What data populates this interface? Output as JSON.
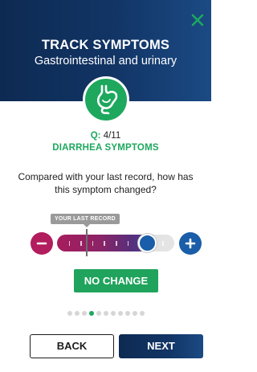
{
  "colors": {
    "header": "#123566",
    "accent_green": "#1da85e",
    "minus": "#b21d5e",
    "plus": "#1a5da8",
    "badge": "#20a35c"
  },
  "header": {
    "title": "TRACK SYMPTOMS",
    "subtitle": "Gastrointestinal and urinary",
    "close_icon": "close-icon"
  },
  "category": {
    "icon": "stomach-icon"
  },
  "question": {
    "prefix": "Q:",
    "count": "4/11",
    "symptom": "DIARRHEA SYMPTOMS",
    "text": "Compared with your last record, how has this symptom changed?"
  },
  "slider": {
    "last_record_label": "YOUR LAST RECORD",
    "level": 0.82,
    "last_record_level": 0.25,
    "minus_icon": "minus-icon",
    "plus_icon": "plus-icon"
  },
  "result": {
    "label": "NO CHANGE"
  },
  "pagination": {
    "total": 11,
    "current": 4
  },
  "footer": {
    "back_label": "BACK",
    "next_label": "NEXT"
  }
}
